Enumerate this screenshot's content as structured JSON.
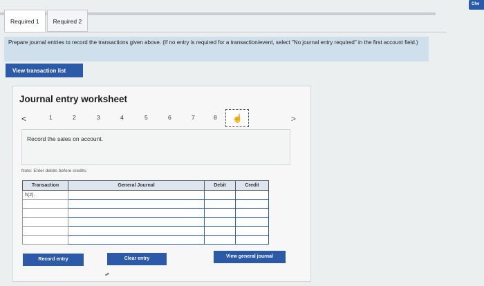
{
  "header": {
    "check_label": "Che",
    "tabs": [
      {
        "label": "Required 1",
        "active": true
      },
      {
        "label": "Required 2",
        "active": false
      }
    ]
  },
  "instructions": {
    "text": "Prepare journal entries to record the transactions given above. (If no entry is required for a transaction/event, select \"No journal entry required\" in the first account field.)"
  },
  "view_transaction_list_label": "View transaction list",
  "worksheet": {
    "title": "Journal entry worksheet",
    "pager": {
      "prev": "<",
      "pages": [
        "1",
        "2",
        "3",
        "4",
        "5",
        "6",
        "7",
        "8"
      ],
      "current_icon": "hand-pointer-icon",
      "next": ">"
    },
    "description": "Record the sales on account.",
    "note": "Note: Enter debits before credits.",
    "table": {
      "columns": [
        "Transaction",
        "General Journal",
        "Debit",
        "Credit"
      ],
      "rows": [
        {
          "transaction": "h(2)."
        },
        {
          "transaction": ""
        },
        {
          "transaction": ""
        },
        {
          "transaction": ""
        },
        {
          "transaction": ""
        },
        {
          "transaction": ""
        }
      ]
    },
    "buttons": {
      "record": "Record entry",
      "clear": "Clear entry",
      "view_general_journal": "View general journal"
    }
  },
  "colors": {
    "accent": "#2c5aa8",
    "instructions_bg": "#cfe0ec",
    "page_bg": "#eceff0"
  }
}
